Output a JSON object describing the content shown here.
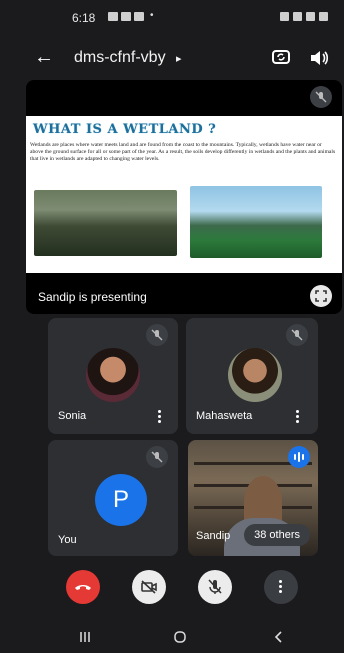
{
  "status_bar": {
    "time": "6:18",
    "indicator": "•"
  },
  "top_bar": {
    "meeting_code": "dms-cfnf-vby",
    "code_caret": "▸",
    "back_icon": "arrow-left-icon",
    "switch_camera_icon": "switch-camera-icon",
    "speaker_icon": "speaker-icon"
  },
  "presentation": {
    "slide_title": "WHAT IS A WETLAND ?",
    "slide_body": "Wetlands are places where water meets land and are found from the coast to the mountains. Typically, wetlands have water near or above the ground surface for all or some part of the year. As a result, the soils develop differently in wetlands and the plants and animals that live in wetlands are adapted to changing water levels.",
    "presenter_label": "Sandip is presenting",
    "fullscreen_icon": "fullscreen-icon"
  },
  "participants": [
    {
      "name": "Sonia",
      "muted": true
    },
    {
      "name": "Mahasweta",
      "muted": true
    },
    {
      "name": "You",
      "initial": "P",
      "muted": true
    },
    {
      "name": "Sandip",
      "others": "38 others"
    }
  ],
  "controls": {
    "end_call_icon": "hang-up-icon",
    "camera_icon": "camera-off-icon",
    "mic_icon": "mic-off-icon",
    "more_icon": "more-vertical-icon"
  },
  "colors": {
    "end_call": "#e53935",
    "accent_blue": "#1a73e8",
    "tile_bg": "#2d2f33",
    "app_bg": "#1b1b1d"
  }
}
